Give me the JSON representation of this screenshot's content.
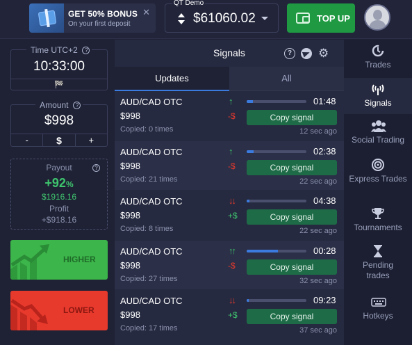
{
  "header": {
    "bonus_title": "GET 50% BONUS",
    "bonus_subtitle": "On your first deposit",
    "bonus_close": "✕",
    "account_label": "QT Demo",
    "balance": "$61060.02",
    "topup_label": "TOP UP"
  },
  "left": {
    "time_label": "Time UTC+2",
    "time_value": "10:33:00",
    "time_flag": "🏁",
    "amount_label": "Amount",
    "amount_value": "$998",
    "minus": "-",
    "currency": "$",
    "plus": "+",
    "payout_label": "Payout",
    "payout_pct": "+92",
    "payout_pct_sign": "%",
    "payout_amount": "$1916.16",
    "profit_label": "Profit",
    "profit_value": "+$918.16",
    "higher_label": "HIGHER",
    "lower_label": "LOWER"
  },
  "signals": {
    "title": "Signals",
    "help_glyph": "?",
    "settings_glyph": "⚙",
    "tabs": [
      "Updates",
      "All"
    ],
    "copy_label": "Copy signal",
    "items": [
      {
        "pair": "AUD/CAD OTC",
        "amount": "$998",
        "copied": "Copied: 0 times",
        "direction": "↑",
        "dir_type": "up",
        "delta": "-$",
        "delta_type": "neg",
        "progress": 0.1,
        "timer": "01:48",
        "ago": "12 sec ago"
      },
      {
        "pair": "AUD/CAD OTC",
        "amount": "$998",
        "copied": "Copied: 21 times",
        "direction": "↑",
        "dir_type": "up",
        "delta": "-$",
        "delta_type": "neg",
        "progress": 0.12,
        "timer": "02:38",
        "ago": "22 sec ago"
      },
      {
        "pair": "AUD/CAD OTC",
        "amount": "$998",
        "copied": "Copied: 8 times",
        "direction": "↓↓",
        "dir_type": "down",
        "delta": "+$",
        "delta_type": "pos",
        "progress": 0.05,
        "timer": "04:38",
        "ago": "22 sec ago"
      },
      {
        "pair": "AUD/CAD OTC",
        "amount": "$998",
        "copied": "Copied: 27 times",
        "direction": "↑↑",
        "dir_type": "up",
        "delta": "-$",
        "delta_type": "neg",
        "progress": 0.52,
        "timer": "00:28",
        "ago": "32 sec ago"
      },
      {
        "pair": "AUD/CAD OTC",
        "amount": "$998",
        "copied": "Copied: 17 times",
        "direction": "↓↓",
        "dir_type": "down",
        "delta": "+$",
        "delta_type": "pos",
        "progress": 0.04,
        "timer": "09:23",
        "ago": "37 sec ago"
      }
    ]
  },
  "sidebar": {
    "items": [
      {
        "label": "Trades",
        "icon": "trades-icon"
      },
      {
        "label": "Signals",
        "icon": "signals-icon"
      },
      {
        "label": "Social Trading",
        "icon": "social-trading-icon"
      },
      {
        "label": "Express Trades",
        "icon": "express-trades-icon"
      },
      {
        "label": "Tournaments",
        "icon": "trophy-icon"
      },
      {
        "label": "Pending trades",
        "icon": "hourglass-icon"
      },
      {
        "label": "Hotkeys",
        "icon": "keyboard-icon"
      }
    ],
    "active": "Signals"
  },
  "colors": {
    "accent_blue": "#3b7be0",
    "green": "#3ec46d",
    "red": "#e8392d",
    "topup_green": "#1f9a43",
    "copy_button": "#1e6b47"
  }
}
